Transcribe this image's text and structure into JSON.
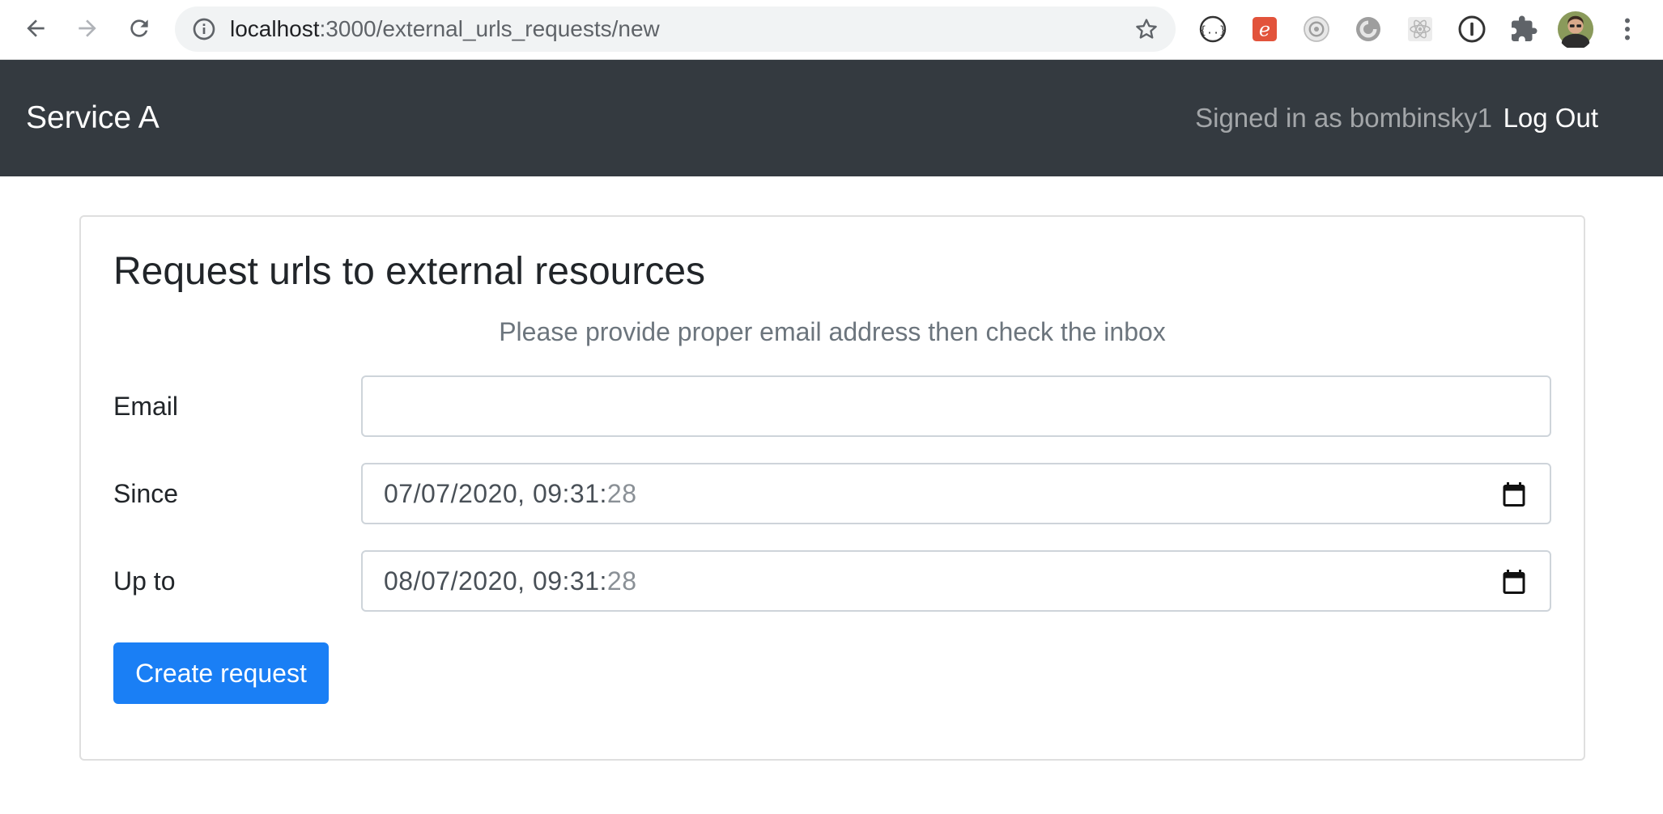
{
  "browser": {
    "url_host": "localhost",
    "url_path": ":3000/external_urls_requests/new",
    "icons": {
      "back": "arrow-left-icon",
      "forward": "arrow-right-icon",
      "reload": "reload-icon",
      "site_info": "info-icon",
      "bookmark": "star-icon",
      "extensions": [
        "json-viewer-icon",
        "evernote-icon",
        "camera-icon",
        "gear-swirl-icon",
        "react-devtools-icon",
        "1password-icon",
        "puzzle-icon"
      ],
      "profile": "avatar",
      "menu": "kebab-menu-icon"
    }
  },
  "navbar": {
    "brand": "Service A",
    "signed_in_text": "Signed in as bombinsky1",
    "logout_label": "Log Out"
  },
  "card": {
    "title": "Request urls to external resources",
    "subtitle": "Please provide proper email address then check the inbox",
    "fields": {
      "email": {
        "label": "Email",
        "value": ""
      },
      "since": {
        "label": "Since",
        "value_main": "07/07/2020, 09:31:",
        "value_secs": "28"
      },
      "up_to": {
        "label": "Up to",
        "value_main": "08/07/2020, 09:31:",
        "value_secs": "28"
      }
    },
    "submit_label": "Create request"
  },
  "colors": {
    "navbar_bg": "#343a40",
    "primary": "#1a7ff5",
    "muted_text": "#6c757d"
  }
}
